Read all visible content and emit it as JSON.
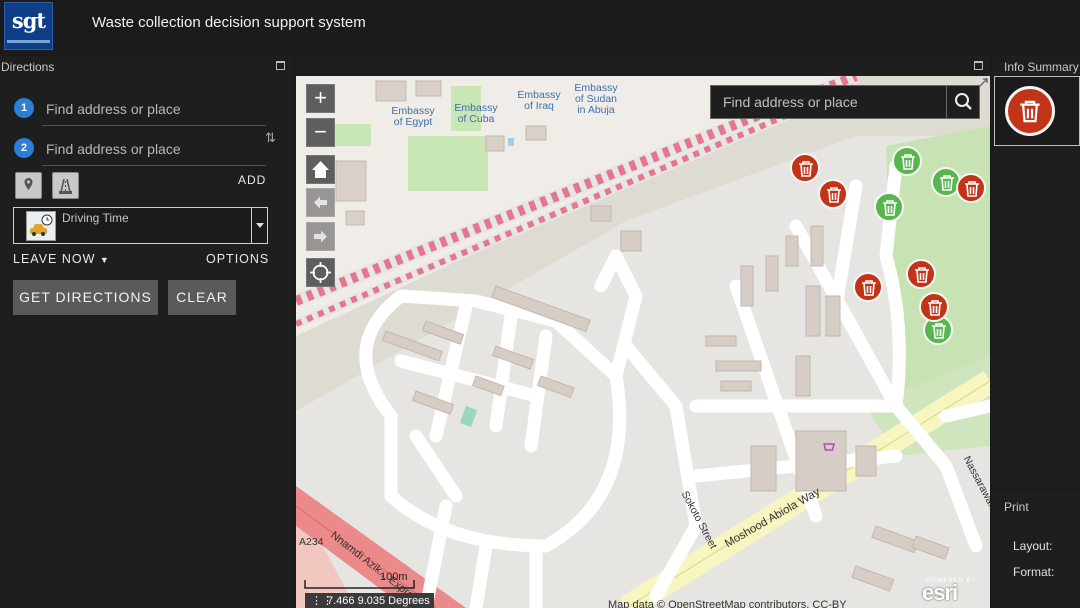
{
  "header": {
    "logo_text": "sgt",
    "title": "Waste collection decision support system"
  },
  "directions": {
    "title": "Directions",
    "stops": [
      {
        "number": "1",
        "placeholder": "Find address or place"
      },
      {
        "number": "2",
        "placeholder": "Find address or place"
      }
    ],
    "add_label": "ADD",
    "travel_mode": "Driving Time",
    "leave_now": "LEAVE NOW",
    "options": "OPTIONS",
    "get_directions": "GET DIRECTIONS",
    "clear": "CLEAR"
  },
  "map": {
    "search_placeholder": "Find address or place",
    "embassies": [
      {
        "name": "Embassy of Egypt"
      },
      {
        "name": "Embassy of Cuba"
      },
      {
        "name": "Embassy of Iraq"
      },
      {
        "name": "Embassy of Sudan in Abuja"
      }
    ],
    "embassy_lines": [
      [
        "Embassy",
        "of Egypt"
      ],
      [
        "Embassy",
        "of Cuba"
      ],
      [
        "Embassy",
        "of Iraq"
      ],
      [
        "Embassy",
        "of Sudan",
        "in Abuja"
      ]
    ],
    "roads": {
      "sokoto": "Sokoto Street",
      "mabiola": "Moshood Abiola Way",
      "nnamdi": "Nnamdi Azik... Express",
      "a234": "A234",
      "nassarawa": "Nassarawa..."
    },
    "scale": "100m",
    "coordinates": "7.466 9.035 Degrees",
    "attribution": "Map data © OpenStreetMap contributors, CC-BY",
    "esri": "esri",
    "powered_by": "POWERED BY",
    "markers": [
      {
        "status": "full",
        "color": "#c23418"
      },
      {
        "status": "full",
        "color": "#c23418"
      },
      {
        "status": "empty",
        "color": "#59b64e"
      },
      {
        "status": "empty",
        "color": "#59b64e"
      },
      {
        "status": "empty",
        "color": "#59b64e"
      },
      {
        "status": "full",
        "color": "#c23418"
      },
      {
        "status": "full",
        "color": "#c23418"
      },
      {
        "status": "full",
        "color": "#c23418"
      },
      {
        "status": "full",
        "color": "#c23418"
      },
      {
        "status": "empty",
        "color": "#59b64e"
      }
    ]
  },
  "info_summary": {
    "title": "Info Summary"
  },
  "print": {
    "title": "Print",
    "layout_label": "Layout:",
    "format_label": "Format:"
  },
  "colors": {
    "accent_blue": "#2c7fd4",
    "full_bin": "#c23418",
    "empty_bin": "#59b64e",
    "panel_bg": "#1e1e1e"
  }
}
